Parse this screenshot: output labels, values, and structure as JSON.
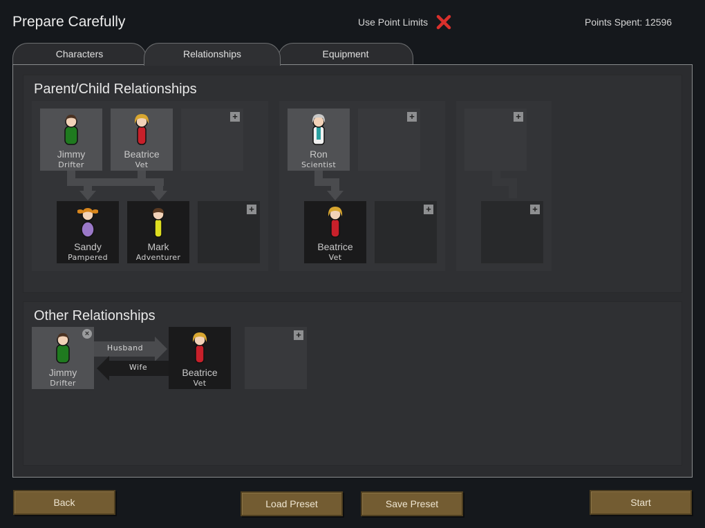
{
  "header": {
    "title": "Prepare Carefully",
    "use_point_limits_label": "Use Point Limits",
    "use_point_limits_icon": "red-x-icon",
    "use_point_limits_enabled": false,
    "points_spent": "Points Spent: 12596"
  },
  "tabs": [
    {
      "label": "Characters",
      "active": false
    },
    {
      "label": "Relationships",
      "active": true
    },
    {
      "label": "Equipment",
      "active": false
    }
  ],
  "parent_child": {
    "title": "Parent/Child Relationships",
    "groups": [
      {
        "parents": [
          {
            "name": "Jimmy",
            "role": "Drifter",
            "body_color": "#1f7a1f",
            "hair_color": "#4a3222"
          },
          {
            "name": "Beatrice",
            "role": "Vet",
            "body_color": "#c8202a",
            "hair_color": "#d8a630"
          }
        ],
        "children": [
          {
            "name": "Sandy",
            "role": "Pampered",
            "body_color": "#9a78c8",
            "hair_color": "#d8861c"
          },
          {
            "name": "Mark",
            "role": "Adventurer",
            "body_color": "#dede20",
            "hair_color": "#5a3a22"
          }
        ]
      },
      {
        "parents": [
          {
            "name": "Ron",
            "role": "Scientist",
            "body_color": "#2aa0a0",
            "hair_color": "#c8c8c8"
          }
        ],
        "children": [
          {
            "name": "Beatrice",
            "role": "Vet",
            "body_color": "#c8202a",
            "hair_color": "#d8a630"
          }
        ]
      },
      {
        "parents": [],
        "children": []
      }
    ],
    "add_icon": "plus-icon"
  },
  "other": {
    "title": "Other Relationships",
    "relations": [
      {
        "source": {
          "name": "Jimmy",
          "role": "Drifter",
          "body_color": "#1f7a1f",
          "hair_color": "#4a3222"
        },
        "target": {
          "name": "Beatrice",
          "role": "Vet",
          "body_color": "#c8202a",
          "hair_color": "#d8a630"
        },
        "forward_label": "Husband",
        "backward_label": "Wife"
      }
    ]
  },
  "footer": {
    "back": "Back",
    "load_preset": "Load Preset",
    "save_preset": "Save Preset",
    "start": "Start"
  }
}
